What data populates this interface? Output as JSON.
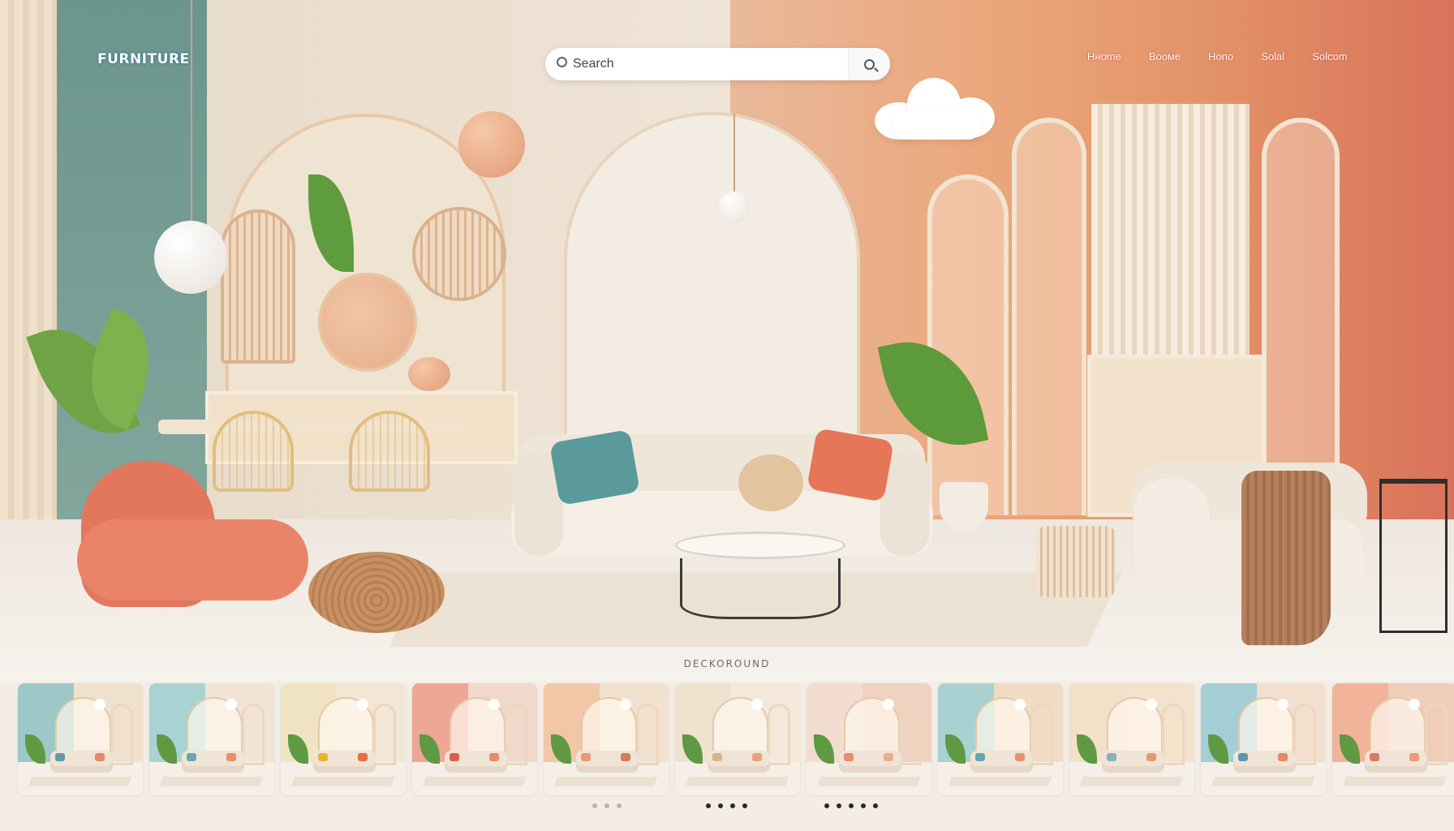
{
  "header": {
    "brand": "FURNITURE",
    "search": {
      "placeholder": "Search",
      "value": ""
    },
    "nav": [
      "Hнome",
      "Booмe",
      "Hono",
      "Solal",
      "Solcom"
    ]
  },
  "section": {
    "label": "DECKOROUND"
  },
  "colors": {
    "accent_coral": "#e2775e",
    "accent_green": "#6b958d",
    "accent_orange": "#eba77c",
    "cream": "#f3ece2",
    "dot_active": "#2b2b2b"
  },
  "thumbnails": [
    {
      "name": "living-room-teal",
      "left": "#9ec7c7",
      "right": "#f0e1cd",
      "pillowA": "#5f9aa8",
      "pillowB": "#e5886a"
    },
    {
      "name": "living-room-mint",
      "left": "#a9d3d3",
      "right": "#f1e4d4",
      "pillowA": "#6aa6b6",
      "pillowB": "#ea8d6b"
    },
    {
      "name": "living-room-yellow",
      "left": "#f0e4c2",
      "right": "#f3e6d4",
      "pillowA": "#e6b530",
      "pillowB": "#e66f48"
    },
    {
      "name": "living-room-coral",
      "left": "#eea794",
      "right": "#f1d8ca",
      "pillowA": "#db5e4c",
      "pillowB": "#e68b6f"
    },
    {
      "name": "living-room-peach",
      "left": "#f2c7a7",
      "right": "#f3e1d0",
      "pillowA": "#e69d72",
      "pillowB": "#d87b5a"
    },
    {
      "name": "living-room-sand",
      "left": "#efe3cf",
      "right": "#f4e8da",
      "pillowA": "#d5b48f",
      "pillowB": "#e9a07e"
    },
    {
      "name": "living-room-blush",
      "left": "#f2ddd0",
      "right": "#f0d2c0",
      "pillowA": "#e58d6f",
      "pillowB": "#eab08d"
    },
    {
      "name": "living-room-aqua",
      "left": "#a8d2d1",
      "right": "#f1dcc3",
      "pillowA": "#66a6b3",
      "pillowB": "#e6906e"
    },
    {
      "name": "living-room-cream",
      "left": "#f1e1c8",
      "right": "#f3e2cc",
      "pillowA": "#8db0c0",
      "pillowB": "#e39a74"
    },
    {
      "name": "living-room-sky",
      "left": "#a5cdd6",
      "right": "#f3dfcd",
      "pillowA": "#5c98ae",
      "pillowB": "#e8866a"
    },
    {
      "name": "living-room-terracotta",
      "left": "#f2b39b",
      "right": "#efcdb8",
      "pillowA": "#d87a60",
      "pillowB": "#ea9a7a"
    }
  ],
  "pagination": {
    "groupA": {
      "count": 3,
      "active": 0
    },
    "groupB": {
      "count": 4,
      "active": 0
    },
    "groupC": {
      "count": 5,
      "active": 0
    }
  }
}
